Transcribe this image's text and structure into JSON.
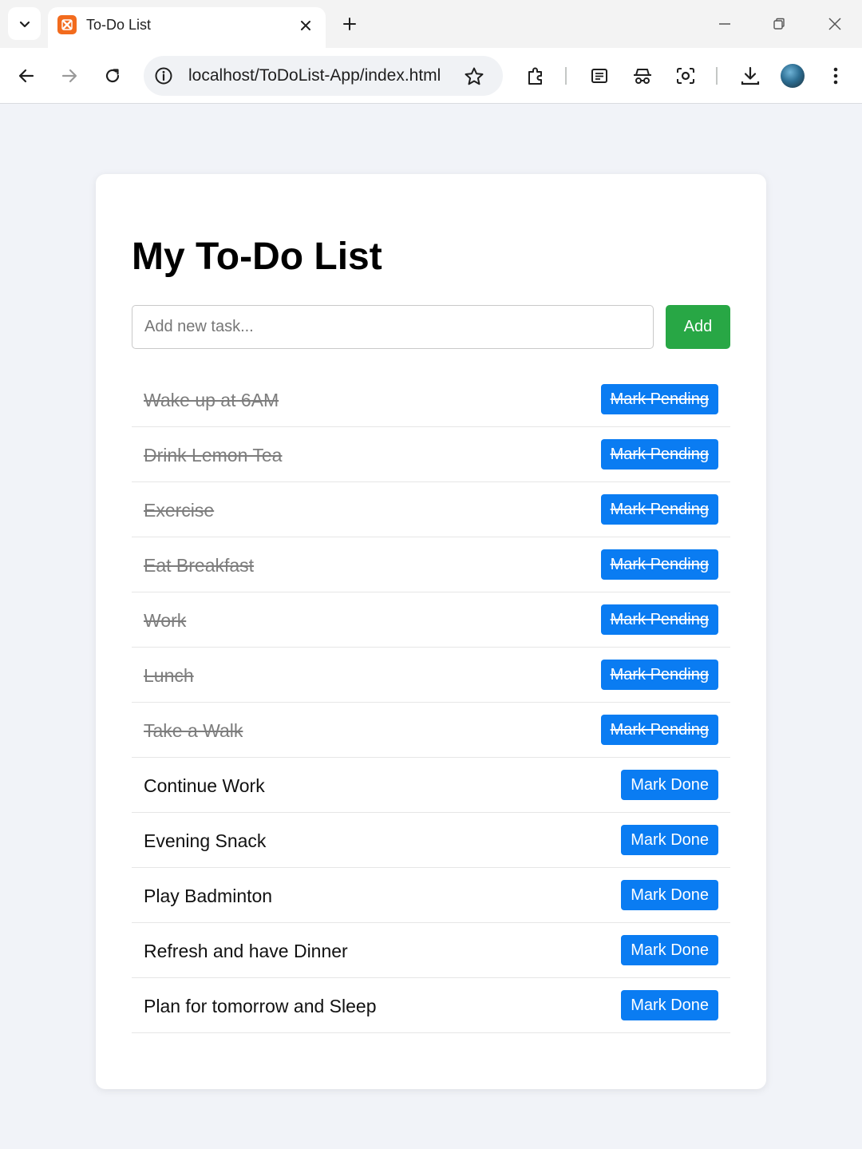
{
  "browser": {
    "tab_title": "To-Do List",
    "url": "localhost/ToDoList-App/index.html",
    "icons": {
      "tab_search": "chevron-down-icon",
      "favicon": "xampp-icon",
      "tab_close": "close-icon",
      "new_tab": "plus-icon",
      "minimize": "minimize-icon",
      "restore": "restore-icon",
      "close_window": "close-icon",
      "back": "arrow-left-icon",
      "forward": "arrow-right-icon",
      "reload": "reload-icon",
      "site_info": "info-icon",
      "bookmark": "star-icon",
      "extensions": "puzzle-icon",
      "reading_list": "reading-list-icon",
      "incognito": "spy-icon",
      "screenshot": "camera-icon",
      "downloads": "download-icon",
      "menu": "kebab-menu-icon"
    }
  },
  "app": {
    "title": "My To-Do List",
    "input_placeholder": "Add new task...",
    "add_label": "Add",
    "tasks": [
      {
        "text": "Wake up at 6AM",
        "done": true,
        "action": "Mark Pending"
      },
      {
        "text": "Drink Lemon Tea",
        "done": true,
        "action": "Mark Pending"
      },
      {
        "text": "Exercise",
        "done": true,
        "action": "Mark Pending"
      },
      {
        "text": "Eat Breakfast",
        "done": true,
        "action": "Mark Pending"
      },
      {
        "text": "Work",
        "done": true,
        "action": "Mark Pending"
      },
      {
        "text": "Lunch",
        "done": true,
        "action": "Mark Pending"
      },
      {
        "text": "Take a Walk",
        "done": true,
        "action": "Mark Pending"
      },
      {
        "text": "Continue Work",
        "done": false,
        "action": "Mark Done"
      },
      {
        "text": "Evening Snack",
        "done": false,
        "action": "Mark Done"
      },
      {
        "text": "Play Badminton",
        "done": false,
        "action": "Mark Done"
      },
      {
        "text": "Refresh and have Dinner",
        "done": false,
        "action": "Mark Done"
      },
      {
        "text": "Plan for tomorrow and Sleep",
        "done": false,
        "action": "Mark Done"
      }
    ],
    "colors": {
      "add_button": "#28a745",
      "action_button": "#0a7cf2",
      "done_text": "#7d7d7d",
      "page_background": "#f1f3f8"
    }
  }
}
